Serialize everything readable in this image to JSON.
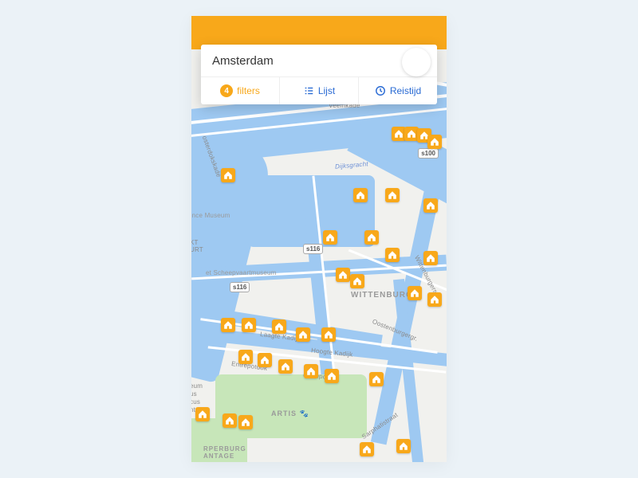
{
  "search": {
    "value": "Amsterdam"
  },
  "controls": {
    "filters": {
      "count": "4",
      "label": "filters"
    },
    "list": {
      "label": "Lijst"
    },
    "travel": {
      "label": "Reistijd"
    }
  },
  "map_labels": {
    "districts": {
      "wittenburg": "WITTENBURG",
      "artis": "ARTIS",
      "plantage_partial": "RPERBURG\nANTAGE",
      "kt_urt": "KT\nURT",
      "plantage_side": "eum\nus\ncus\nntage"
    },
    "streets": {
      "veemkade": "Veemkade",
      "dijksgracht": "Dijksgracht",
      "oosterdokskade": "osterdokskade",
      "laagte_kadijk": "Laagte Kadijk",
      "hoogte_kadijk": "Hoogte Kadijk",
      "entrepotdok_a": "Entrepotdok",
      "entrepotdok_b": "Entrepotdok",
      "oostenburgergr": "Oostenburgergr.",
      "wittenburgerstr": "Wittenburgers",
      "sarphatistraat": "Sarphatistraat",
      "science_museum": "ence Museum",
      "scheepvaart": "et Scheepvaartmuseum"
    },
    "shields": {
      "s100": "s100",
      "s116a": "s116",
      "s116b": "s116"
    }
  },
  "icons": {
    "list": "list-icon",
    "clock": "clock-icon",
    "house": "house-icon"
  }
}
